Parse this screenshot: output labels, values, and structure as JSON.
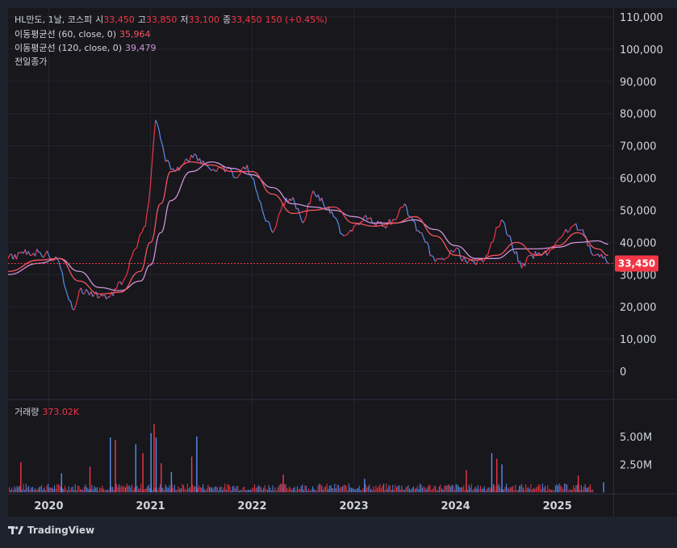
{
  "legend": {
    "symbol": "HL만도, 1날, 코스피",
    "open_label": "시",
    "open": "33,450",
    "high_label": "고",
    "high": "33,850",
    "low_label": "저",
    "low": "33,100",
    "close_label": "종",
    "close": "33,450",
    "change": "150 (+0.45%)",
    "ma60_label": "이동평균선 (60, close, 0)",
    "ma60_value": "35,964",
    "ma120_label": "이동평균선 (120, close, 0)",
    "ma120_value": "39,479",
    "prev_close_label": "전일종가"
  },
  "volume_legend": {
    "label": "거래량",
    "value": "373.02K"
  },
  "price_badge": "33,450",
  "brand": "TradingView",
  "colors": {
    "up": "#f23645",
    "down": "#5b8def",
    "ma60": "#f7525f",
    "ma120": "#ce93d8",
    "bg": "#1e222d",
    "pane": "#17171c"
  },
  "chart_data": [
    {
      "type": "line",
      "title": "",
      "x_axis_labels": [
        "2020",
        "2021",
        "2022",
        "2023",
        "2024",
        "2025"
      ],
      "y_axis_labels": [
        "110,000",
        "100,000",
        "90,000",
        "80,000",
        "70,000",
        "60,000",
        "50,000",
        "40,000",
        "30,000",
        "20,000",
        "10,000",
        "0"
      ],
      "ylim": [
        0,
        110000
      ],
      "xlim": [
        2019.6,
        2025.55
      ],
      "grid": true,
      "series": [
        {
          "name": "close",
          "x": [
            2019.6,
            2019.75,
            2019.9,
            2020.0,
            2020.1,
            2020.2,
            2020.25,
            2020.3,
            2020.45,
            2020.6,
            2020.75,
            2020.85,
            2020.95,
            2021.0,
            2021.05,
            2021.1,
            2021.15,
            2021.25,
            2021.35,
            2021.45,
            2021.55,
            2021.65,
            2021.75,
            2021.85,
            2021.95,
            2022.0,
            2022.1,
            2022.2,
            2022.3,
            2022.4,
            2022.5,
            2022.6,
            2022.7,
            2022.8,
            2022.9,
            2023.0,
            2023.1,
            2023.2,
            2023.3,
            2023.4,
            2023.5,
            2023.55,
            2023.7,
            2023.8,
            2023.9,
            2024.0,
            2024.1,
            2024.2,
            2024.3,
            2024.35,
            2024.45,
            2024.55,
            2024.65,
            2024.75,
            2024.85,
            2024.95,
            2025.05,
            2025.15,
            2025.25,
            2025.35,
            2025.45,
            2025.5
          ],
          "values": [
            35000,
            36500,
            37000,
            36000,
            34000,
            22000,
            19000,
            25000,
            24000,
            23000,
            29000,
            38000,
            45000,
            58000,
            78000,
            72000,
            65000,
            62000,
            66000,
            67000,
            64000,
            62000,
            63000,
            60000,
            64000,
            60000,
            50000,
            43000,
            52000,
            54000,
            46000,
            56000,
            52000,
            48000,
            42000,
            45000,
            48000,
            46000,
            45000,
            47000,
            52000,
            48000,
            40000,
            34000,
            35000,
            38000,
            34000,
            33000,
            36000,
            40000,
            47000,
            40000,
            32000,
            36000,
            36000,
            38000,
            42000,
            45000,
            44000,
            36000,
            35000,
            33450
          ]
        },
        {
          "name": "이동평균선 (60, close, 0)",
          "x": [
            2019.6,
            2019.9,
            2020.1,
            2020.3,
            2020.5,
            2020.7,
            2020.9,
            2021.0,
            2021.1,
            2021.2,
            2021.4,
            2021.6,
            2021.8,
            2022.0,
            2022.2,
            2022.4,
            2022.6,
            2022.8,
            2023.0,
            2023.2,
            2023.4,
            2023.6,
            2023.8,
            2024.0,
            2024.2,
            2024.4,
            2024.6,
            2024.8,
            2025.0,
            2025.2,
            2025.4,
            2025.5
          ],
          "values": [
            31000,
            34500,
            35000,
            28000,
            24000,
            24500,
            31000,
            40000,
            52000,
            62000,
            65000,
            64000,
            62000,
            62000,
            55000,
            49000,
            50000,
            51000,
            46000,
            45000,
            46000,
            48000,
            42000,
            36000,
            34500,
            36000,
            40000,
            36000,
            39000,
            43000,
            38000,
            35964
          ]
        },
        {
          "name": "이동평균선 (120, close, 0)",
          "x": [
            2019.6,
            2019.9,
            2020.1,
            2020.3,
            2020.5,
            2020.7,
            2020.9,
            2021.0,
            2021.1,
            2021.2,
            2021.4,
            2021.6,
            2021.8,
            2022.0,
            2022.2,
            2022.4,
            2022.6,
            2022.8,
            2023.0,
            2023.2,
            2023.4,
            2023.6,
            2023.8,
            2024.0,
            2024.2,
            2024.4,
            2024.6,
            2024.8,
            2025.0,
            2025.2,
            2025.4,
            2025.5
          ],
          "values": [
            30000,
            33500,
            35000,
            31000,
            26000,
            25000,
            28000,
            33000,
            43000,
            53000,
            62000,
            65000,
            63000,
            61000,
            57000,
            52000,
            51000,
            50000,
            48000,
            46000,
            46000,
            47000,
            44000,
            39000,
            35000,
            35000,
            38000,
            38000,
            38500,
            40000,
            40500,
            39479
          ]
        }
      ],
      "prev_close": 33450
    },
    {
      "type": "bar",
      "title": "거래량",
      "y_axis_labels": [
        "5.00M",
        "2.50M"
      ],
      "ylim": [
        0,
        6500000
      ],
      "xlim": [
        2019.6,
        2025.55
      ],
      "series": [
        {
          "name": "spikes",
          "x": [
            2019.72,
            2020.12,
            2020.4,
            2020.6,
            2020.65,
            2020.85,
            2020.92,
            2021.0,
            2021.03,
            2021.05,
            2021.1,
            2021.2,
            2021.4,
            2021.45,
            2022.3,
            2023.1,
            2024.1,
            2024.35,
            2024.4,
            2024.45,
            2025.2,
            2025.45
          ],
          "values": [
            2700000,
            1700000,
            2300000,
            4900000,
            4700000,
            4300000,
            3500000,
            5300000,
            6100000,
            4900000,
            2600000,
            1800000,
            3200000,
            5000000,
            1600000,
            1200000,
            2000000,
            3500000,
            3000000,
            2500000,
            1500000,
            900000
          ]
        }
      ]
    }
  ]
}
